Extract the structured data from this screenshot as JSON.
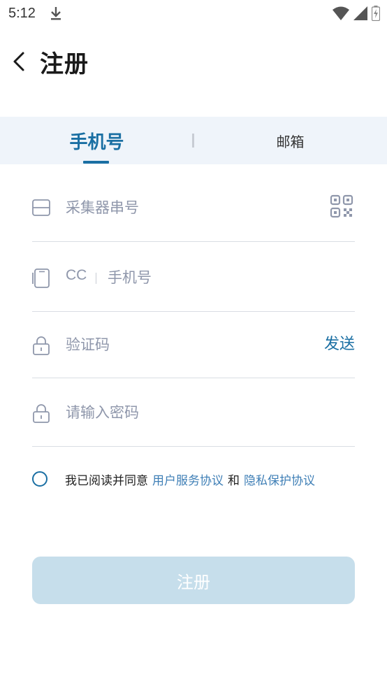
{
  "status_bar": {
    "time": "5:12",
    "icons": [
      "download-icon",
      "wifi-icon",
      "signal-icon",
      "battery-charging-icon"
    ]
  },
  "header": {
    "title": "注册",
    "back_icon": "back-arrow-icon"
  },
  "tabs": [
    {
      "label": "手机号",
      "active": true
    },
    {
      "label": "邮箱",
      "active": false
    }
  ],
  "form": {
    "serial": {
      "placeholder": "采集器串号",
      "value": "",
      "icon": "device-icon",
      "action_icon": "qr-code-icon"
    },
    "phone": {
      "country_code": "CC",
      "placeholder": "手机号",
      "value": "",
      "icon": "phone-icon"
    },
    "code": {
      "placeholder": "验证码",
      "value": "",
      "icon": "lock-icon",
      "send_label": "发送"
    },
    "password": {
      "placeholder": "请输入密码",
      "value": "",
      "icon": "lock-icon"
    }
  },
  "agreement": {
    "checked": false,
    "prefix": "我已阅读并同意",
    "terms_link": "用户服务协议",
    "conjunction": "和",
    "privacy_link": "隐私保护协议"
  },
  "submit": {
    "label": "注册"
  },
  "colors": {
    "accent": "#1a6fa3",
    "link": "#3f7fb6",
    "tab_bg": "#eff4fa",
    "button_disabled": "#c6deeb",
    "placeholder": "#8f97ab"
  }
}
